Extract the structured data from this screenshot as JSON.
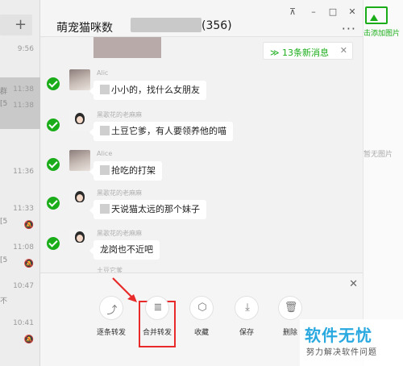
{
  "sidebar": {
    "plus_label": "+",
    "sessions": [
      {
        "time": "9:56",
        "snippet": "",
        "muted": false
      },
      {
        "time": "11:38",
        "snippet": "群",
        "muted": false
      },
      {
        "time": "11:38",
        "snippet": "[5",
        "muted": false
      },
      {
        "time": "11:36",
        "snippet": "",
        "muted": false
      },
      {
        "time": "11:33",
        "snippet": "[5",
        "muted": true
      },
      {
        "time": "11:08",
        "snippet": "[5",
        "muted": true
      },
      {
        "time": "10:47",
        "snippet": "不",
        "muted": false
      },
      {
        "time": "10:41",
        "snippet": "",
        "muted": true
      }
    ]
  },
  "chat": {
    "title": "萌宠猫咪数",
    "title_count": "(356)",
    "window_controls": {
      "pin": "⊼",
      "minimize": "–",
      "maximize": "□",
      "close": "✕"
    },
    "more_label": "···",
    "new_messages": {
      "text": "13条新消息",
      "close": "✕"
    },
    "messages": [
      {
        "nickname": "Alic",
        "text": "小小的，找什么女朋友",
        "selected": true
      },
      {
        "nickname": "黑歌花的老麻麻",
        "text": "土豆它爹，有人要领养他的喵",
        "selected": true
      },
      {
        "nickname": "Alice",
        "text": "抢吃的打架",
        "selected": true
      },
      {
        "nickname": "黑歌花的老麻麻",
        "text": "天说猫太远的那个妹子",
        "selected": true
      },
      {
        "nickname": "黑歌花的老麻麻",
        "text": "龙岗也不近吧",
        "selected": true
      }
    ],
    "last_nickname": "土豆它爹"
  },
  "forward_panel": {
    "close": "✕",
    "actions": [
      {
        "label": "逐条转发",
        "icon": "share-icon"
      },
      {
        "label": "合并转发",
        "icon": "merge-forward-icon"
      },
      {
        "label": "收藏",
        "icon": "cube-icon"
      },
      {
        "label": "保存",
        "icon": "download-icon"
      },
      {
        "label": "删除",
        "icon": "trash-icon"
      }
    ]
  },
  "right_panel": {
    "add_image_label": "击添加图片",
    "no_image_label": "暂无图片"
  },
  "watermark": {
    "main": "软件无忧",
    "sub": "努力解决软件问题"
  },
  "colors": {
    "accent": "#1aad19",
    "highlight": "#e82a2a",
    "watermark": "#29a9e0"
  }
}
